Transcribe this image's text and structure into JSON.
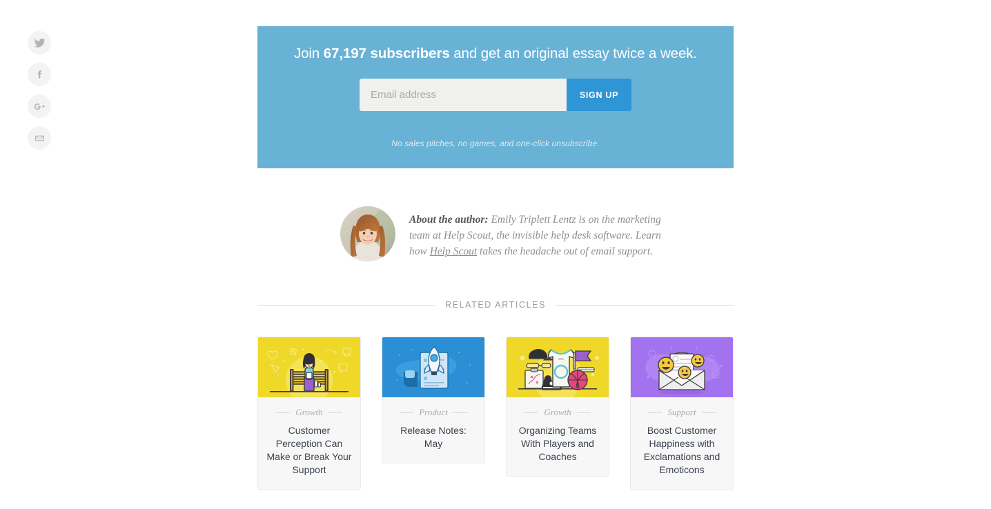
{
  "social": {
    "items": [
      {
        "name": "twitter",
        "label": "Share on Twitter"
      },
      {
        "name": "facebook",
        "label": "Share on Facebook"
      },
      {
        "name": "googleplus",
        "label": "Share on Google Plus"
      },
      {
        "name": "email",
        "label": "Share by Email"
      }
    ]
  },
  "signup": {
    "headline_prefix": "Join ",
    "headline_count": "67,197 subscribers",
    "headline_suffix": " and get an original essay twice a week.",
    "email_placeholder": "Email address",
    "email_value": "",
    "submit_label": "SIGN UP",
    "note": "No sales pitches, no games, and one-click unsubscribe.",
    "background_color": "#68b2d6",
    "button_color": "#2e96d7"
  },
  "author": {
    "lead": "About the author:",
    "text_before_link": " Emily Triplett Lentz is on the marketing team at Help Scout, the invisible help desk software. Learn how ",
    "link_text": "Help Scout",
    "text_after_link": " takes the headache out of email support."
  },
  "related": {
    "section_title": "RELATED ARTICLES",
    "cards": [
      {
        "category": "Growth",
        "title": "Customer Perception Can Make or Break Your Support",
        "thumb_color": "#f0d829",
        "thumb_art": "woman-on-bench-illustration"
      },
      {
        "category": "Product",
        "title": "Release Notes: May",
        "thumb_color": "#2a8fd4",
        "thumb_art": "rocket-document-illustration"
      },
      {
        "category": "Growth",
        "title": "Organizing Teams With Players and Coaches",
        "thumb_color": "#f0d829",
        "thumb_art": "sports-gear-illustration"
      },
      {
        "category": "Support",
        "title": "Boost Customer Happiness with Exclamations and Emoticons",
        "thumb_color": "#a272ef",
        "thumb_art": "envelope-emoticons-illustration"
      }
    ]
  }
}
